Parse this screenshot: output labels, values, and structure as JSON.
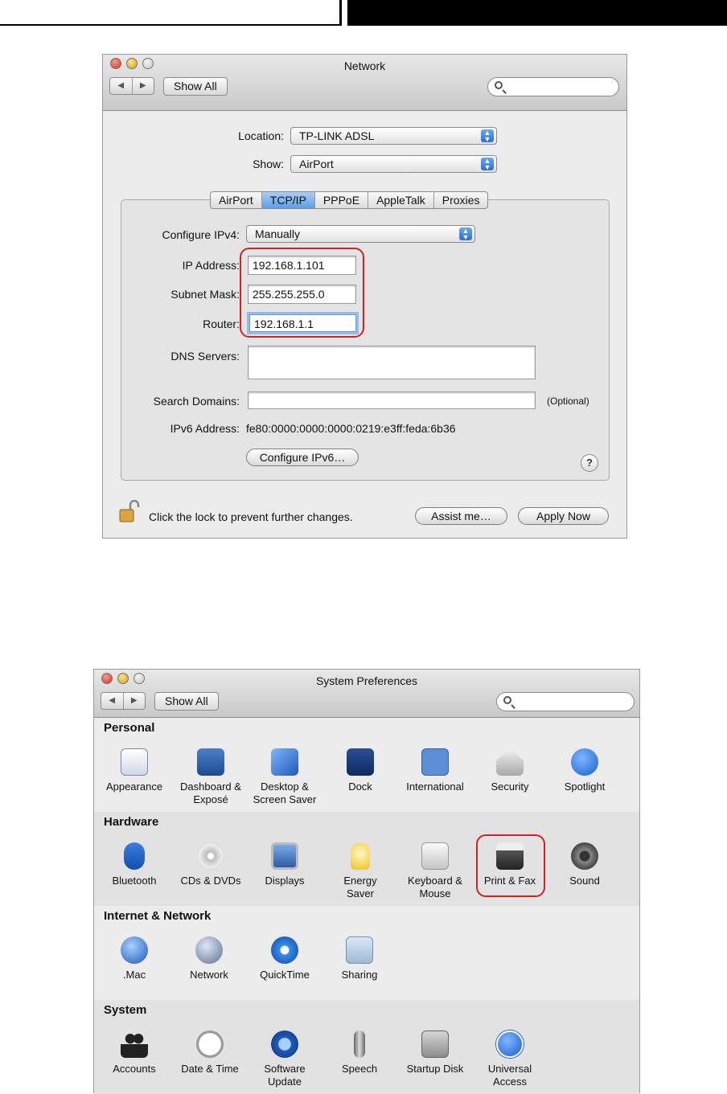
{
  "network": {
    "title": "Network",
    "nav_back": "◀",
    "nav_fwd": "▶",
    "show_all": "Show All",
    "location_label": "Location:",
    "location_value": "TP-LINK ADSL",
    "show_label": "Show:",
    "show_value": "AirPort",
    "tabs": [
      "AirPort",
      "TCP/IP",
      "PPPoE",
      "AppleTalk",
      "Proxies"
    ],
    "configure_ipv4_label": "Configure IPv4:",
    "configure_ipv4_value": "Manually",
    "ip_label": "IP Address:",
    "ip_value": "192.168.1.101",
    "subnet_label": "Subnet Mask:",
    "subnet_value": "255.255.255.0",
    "router_label": "Router:",
    "router_value": "192.168.1.1",
    "dns_label": "DNS Servers:",
    "dns_value": "",
    "search_domains_label": "Search Domains:",
    "search_domains_value": "",
    "optional": "(Optional)",
    "ipv6_label": "IPv6 Address:",
    "ipv6_value": "fe80:0000:0000:0000:0219:e3ff:feda:6b36",
    "configure_ipv6": "Configure IPv6…",
    "help": "?",
    "lock_text": "Click the lock to prevent further changes.",
    "assist": "Assist me…",
    "apply": "Apply Now"
  },
  "sysprefs": {
    "title": "System Preferences",
    "show_all": "Show All",
    "sections": [
      {
        "title": "Personal",
        "items": [
          [
            "Appearance",
            ""
          ],
          [
            "Dashboard &",
            "Exposé"
          ],
          [
            "Desktop &",
            "Screen Saver"
          ],
          [
            "Dock",
            ""
          ],
          [
            "International",
            ""
          ],
          [
            "Security",
            ""
          ],
          [
            "Spotlight",
            ""
          ]
        ]
      },
      {
        "title": "Hardware",
        "items": [
          [
            "Bluetooth",
            ""
          ],
          [
            "CDs & DVDs",
            ""
          ],
          [
            "Displays",
            ""
          ],
          [
            "Energy",
            "Saver"
          ],
          [
            "Keyboard &",
            "Mouse"
          ],
          [
            "Print & Fax",
            ""
          ],
          [
            "Sound",
            ""
          ]
        ]
      },
      {
        "title": "Internet & Network",
        "items": [
          [
            ".Mac",
            ""
          ],
          [
            "Network",
            ""
          ],
          [
            "QuickTime",
            ""
          ],
          [
            "Sharing",
            ""
          ]
        ]
      },
      {
        "title": "System",
        "items": [
          [
            "Accounts",
            ""
          ],
          [
            "Date & Time",
            ""
          ],
          [
            "Software",
            "Update"
          ],
          [
            "Speech",
            ""
          ],
          [
            "Startup Disk",
            ""
          ],
          [
            "Universal",
            "Access"
          ]
        ]
      }
    ]
  },
  "colors": {
    "highlight": "#d62020",
    "accent": "#2c6fd6"
  }
}
